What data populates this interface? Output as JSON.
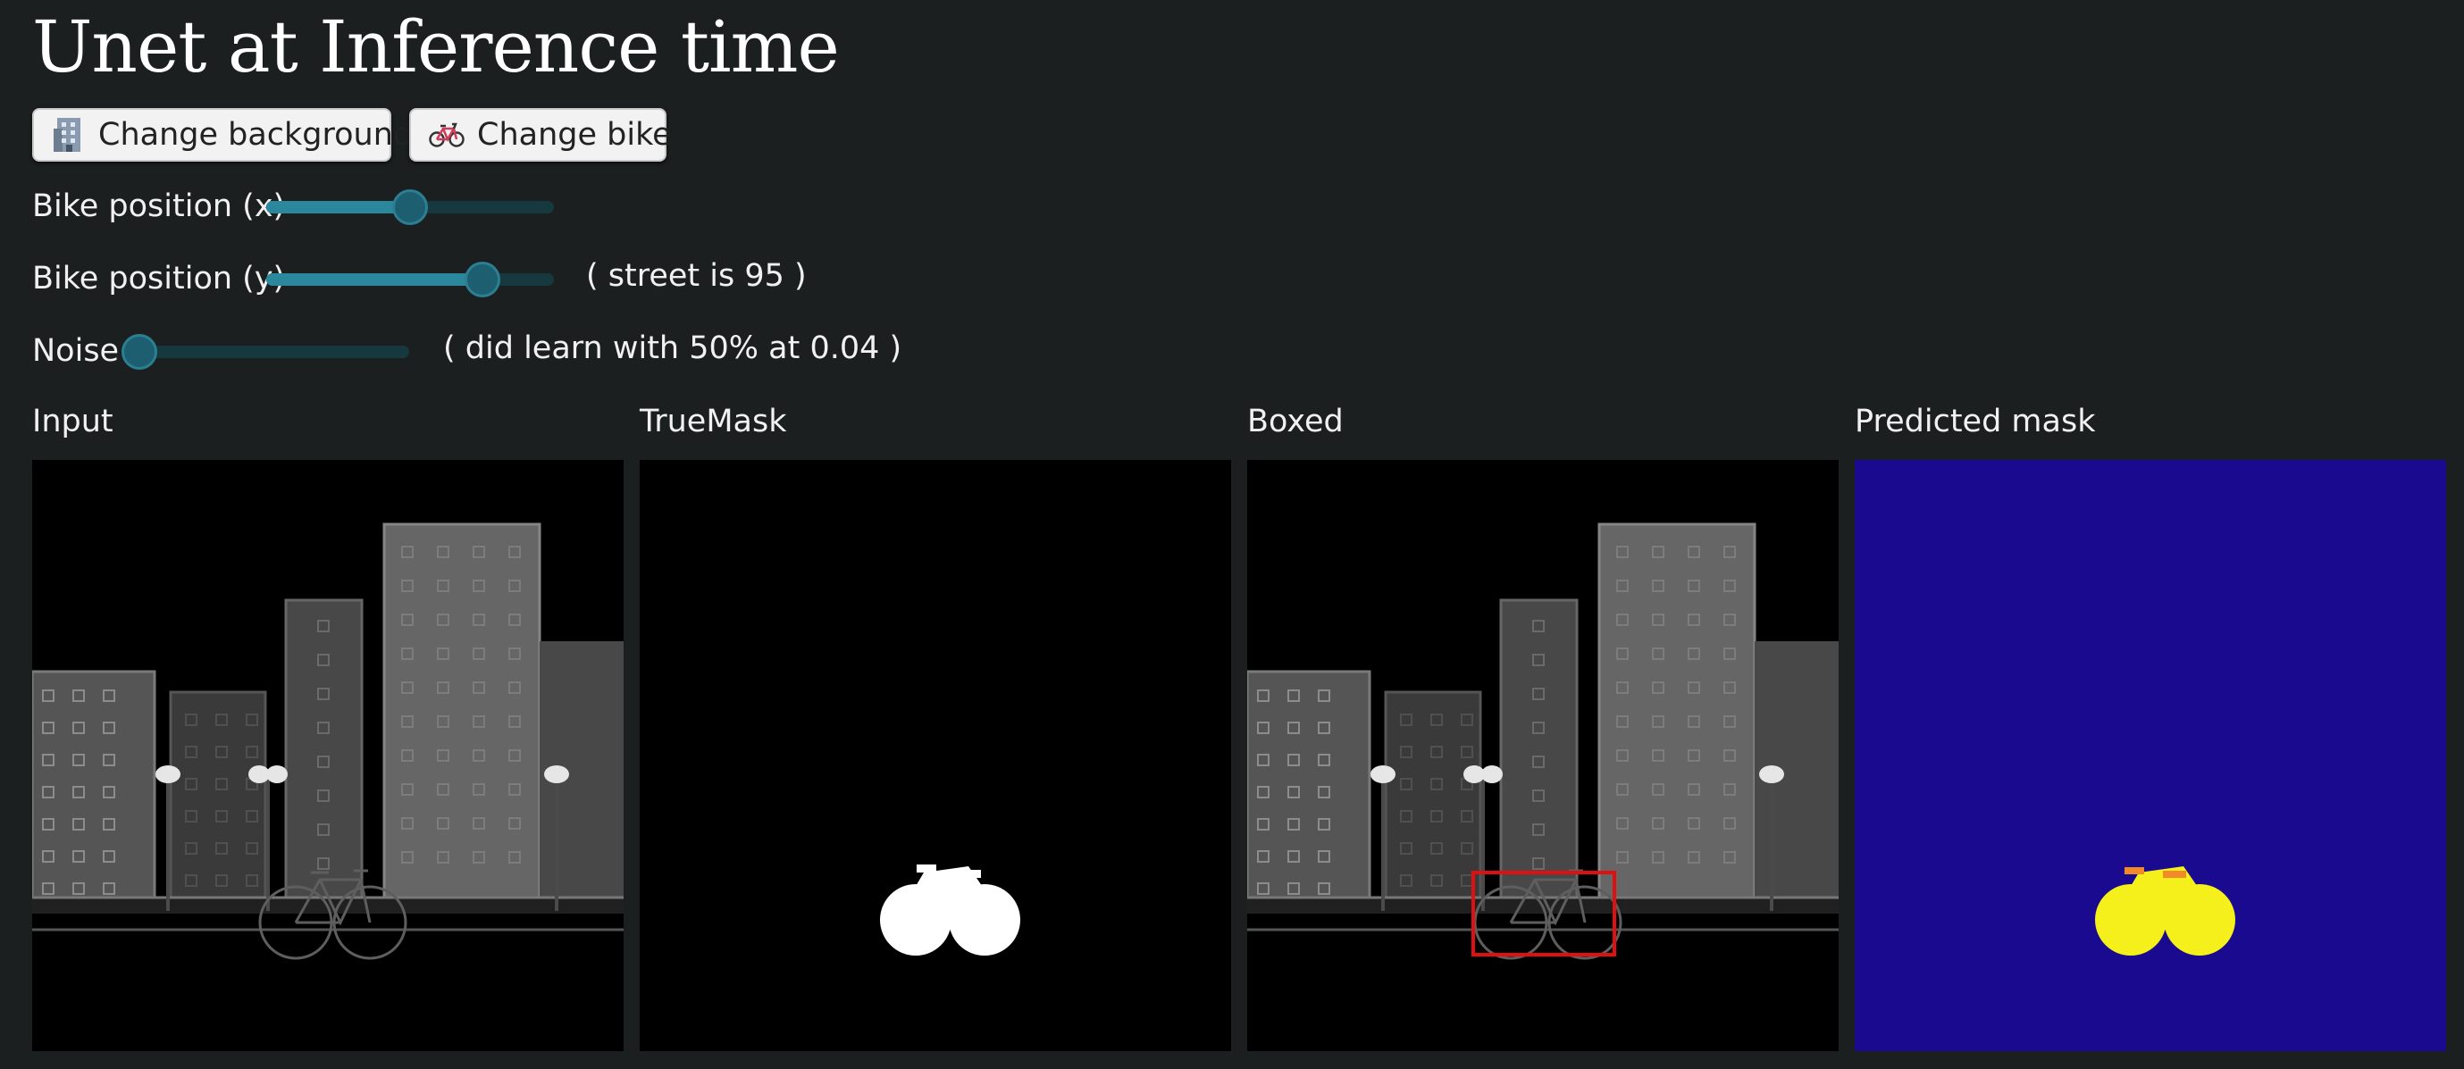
{
  "page": {
    "title": "Unet at Inference time"
  },
  "buttons": {
    "change_background": {
      "label": "Change background",
      "icon": "building-icon"
    },
    "change_bike": {
      "label": "Change bike",
      "icon": "bicycle-icon"
    }
  },
  "controls": {
    "bike_x": {
      "label": "Bike position (x)",
      "value_fraction": 0.5
    },
    "bike_y": {
      "label": "Bike position (y)",
      "value_fraction": 0.75,
      "note": "( street is 95 )"
    },
    "noise": {
      "label": "Noise",
      "value_fraction": 0.0,
      "note": "( did learn with 50% at 0.04 )"
    }
  },
  "panels": {
    "input": {
      "label": "Input"
    },
    "true_mask": {
      "label": "TrueMask"
    },
    "boxed": {
      "label": "Boxed"
    },
    "predicted": {
      "label": "Predicted mask"
    }
  },
  "colors": {
    "background": "#1b1f1f",
    "slider_fill": "#2b879b",
    "slider_track": "#15393e",
    "box_outline": "#e01010",
    "mask_background": "#1a0a8f",
    "mask_foreground": "#f5ef1c"
  }
}
